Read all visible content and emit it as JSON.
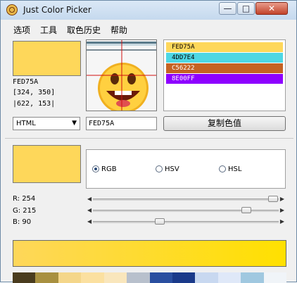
{
  "window": {
    "title": "Just Color Picker",
    "minimize": "—",
    "maximize": "□",
    "close": "✕"
  },
  "menu": [
    "选项",
    "工具",
    "取色历史",
    "帮助"
  ],
  "current": {
    "color": "#FED75A",
    "hex_label": "FED75A",
    "pos1": "[324, 350]",
    "pos2": "|622, 153|"
  },
  "history": [
    {
      "label": "FED75A",
      "color": "#FED75A",
      "text_color": "#000000"
    },
    {
      "label": "4DD7E4",
      "color": "#4DD7E4",
      "text_color": "#000000"
    },
    {
      "label": "C56222",
      "color": "#C56222",
      "text_color": "#ffffff"
    },
    {
      "label": "8E00FF",
      "color": "#8E00FF",
      "text_color": "#ffffff"
    }
  ],
  "format": {
    "selected": "HTML"
  },
  "hex_field": "FED75A",
  "copy_button": "复制色值",
  "modes": [
    {
      "label": "RGB",
      "selected": true
    },
    {
      "label": "HSV",
      "selected": false
    },
    {
      "label": "HSL",
      "selected": false
    }
  ],
  "channels": [
    {
      "label": "R: 254",
      "value": 254
    },
    {
      "label": "G: 215",
      "value": 215
    },
    {
      "label": "B: 90",
      "value": 90
    }
  ],
  "colors": {
    "gradient_start": "#FED75A",
    "gradient_end": "#FFE000",
    "palette": [
      "#4a3c1e",
      "#a89040",
      "#f4d68a",
      "#fbe0a0",
      "#f9e6bc",
      "#b8c0cc",
      "#2a4fa0",
      "#1a3a8a",
      "#c8d8f0",
      "#dfe8f8",
      "#a0c8e0",
      "#f0f4f8"
    ]
  }
}
